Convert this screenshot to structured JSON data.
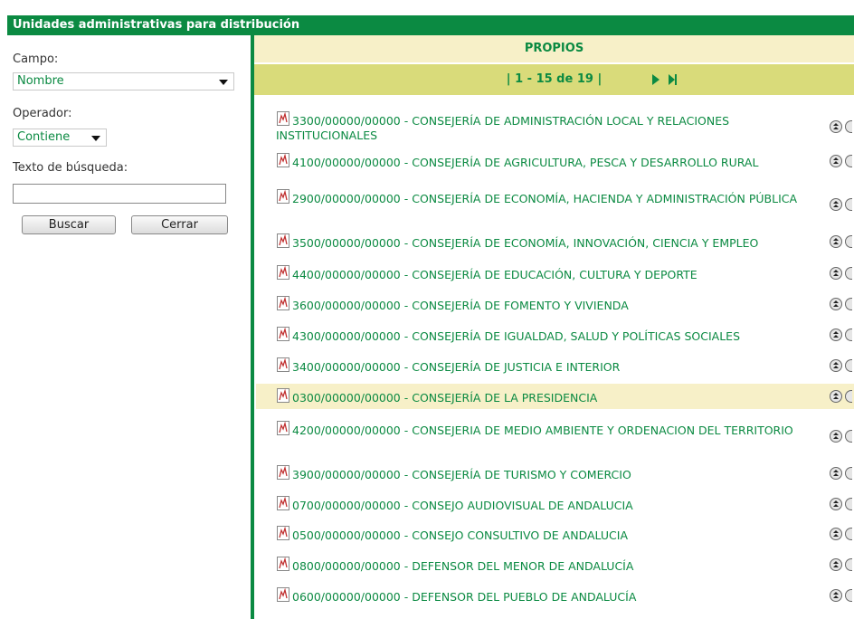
{
  "window": {
    "title": "Unidades administrativas para distribución"
  },
  "search": {
    "campo_label": "Campo:",
    "campo_value": "Nombre",
    "operador_label": "Operador:",
    "operador_value": "Contiene",
    "texto_label": "Texto de búsqueda:",
    "texto_value": "",
    "buscar_label": "Buscar",
    "cerrar_label": "Cerrar"
  },
  "results": {
    "header": "PROPIOS",
    "pager_text": "| 1 - 15 de 19 |",
    "items": [
      {
        "text": "3300/00000/00000 - CONSEJERÍA DE ADMINISTRACIÓN LOCAL Y RELACIONES INSTITUCIONALES"
      },
      {
        "text": "4100/00000/00000 - CONSEJERÍA DE AGRICULTURA, PESCA Y DESARROLLO RURAL"
      },
      {
        "text": "2900/00000/00000 - CONSEJERÍA DE ECONOMÍA, HACIENDA Y ADMINISTRACIÓN PÚBLICA"
      },
      {
        "text": "3500/00000/00000 - CONSEJERÍA DE ECONOMÍA, INNOVACIÓN, CIENCIA Y EMPLEO"
      },
      {
        "text": "4400/00000/00000 - CONSEJERÍA DE EDUCACIÓN, CULTURA Y DEPORTE"
      },
      {
        "text": "3600/00000/00000 - CONSEJERÍA DE FOMENTO Y VIVIENDA"
      },
      {
        "text": "4300/00000/00000 - CONSEJERÍA DE IGUALDAD, SALUD Y POLÍTICAS SOCIALES"
      },
      {
        "text": "3400/00000/00000 - CONSEJERÍA DE JUSTICIA E INTERIOR"
      },
      {
        "text": "0300/00000/00000 - CONSEJERÍA DE LA PRESIDENCIA"
      },
      {
        "text": "4200/00000/00000 - CONSEJERIA DE MEDIO AMBIENTE Y ORDENACION DEL TERRITORIO"
      },
      {
        "text": "3900/00000/00000 - CONSEJERÍA DE TURISMO Y COMERCIO"
      },
      {
        "text": "0700/00000/00000 - CONSEJO AUDIOVISUAL DE ANDALUCIA"
      },
      {
        "text": "0500/00000/00000 - CONSEJO CONSULTIVO DE ANDALUCIA"
      },
      {
        "text": "0800/00000/00000 - DEFENSOR DEL MENOR DE ANDALUCÍA"
      },
      {
        "text": "0600/00000/00000 - DEFENSOR DEL PUEBLO DE ANDALUCÍA"
      }
    ]
  },
  "colors": {
    "accent": "#0b8a42",
    "header_bg": "#f7f0c8",
    "pager_bg": "#d9db7a"
  },
  "icons": {
    "item": "document-icon",
    "next": "next-page-icon",
    "last": "last-page-icon",
    "expand": "expand-up-icon"
  }
}
